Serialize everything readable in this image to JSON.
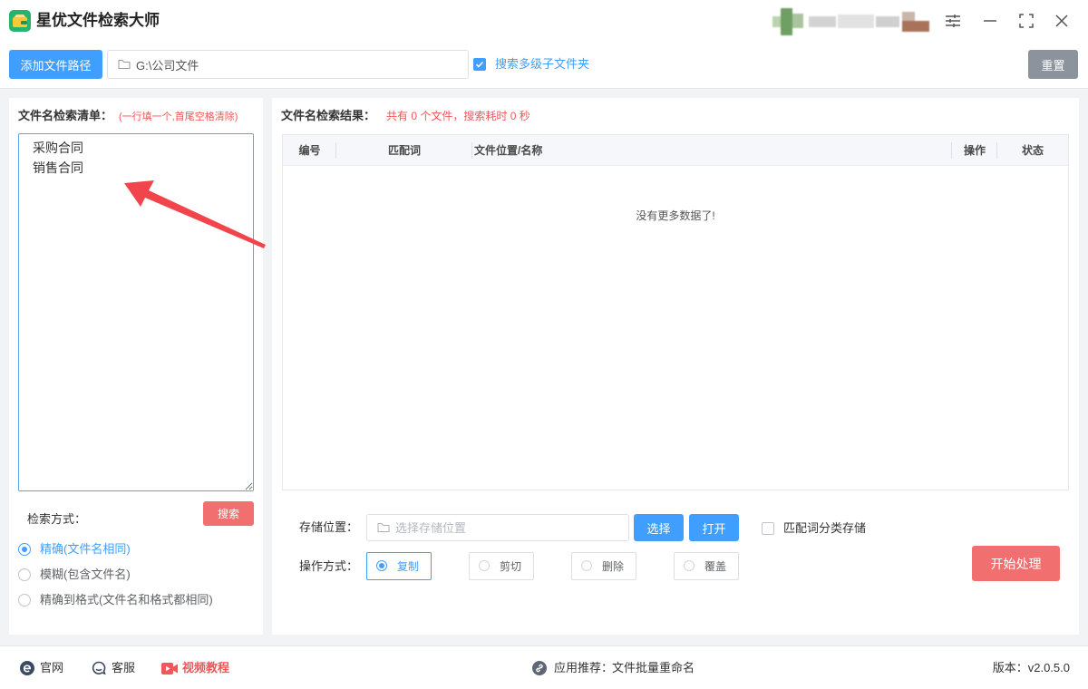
{
  "theme": {
    "primary": "#409eff",
    "danger": "#f26f6f",
    "muted": "#8d939c",
    "hint": "#f25656",
    "arrow": "#f2454b",
    "video": "#f0565a"
  },
  "app": {
    "title": "星优文件检索大师",
    "icons": [
      "app-logo-icon",
      "settings-sliders-icon",
      "minimize-icon",
      "maximize-icon",
      "close-icon"
    ]
  },
  "toolbar": {
    "add_path_label": "添加文件路径",
    "path_value": "G:\\公司文件",
    "subfolder_checked": true,
    "subfolder_label": "搜索多级子文件夹",
    "reset_label": "重置"
  },
  "left_panel": {
    "list_label": "文件名检索清单：",
    "list_hint": "(一行填一个,首尾空格清除)",
    "list_value": "采购合同\n销售合同",
    "mode_label": "检索方式：",
    "search_label": "搜索",
    "modes": [
      {
        "label": "精确(文件名相同)",
        "selected": true
      },
      {
        "label": "模糊(包含文件名)",
        "selected": false
      },
      {
        "label": "精确到格式(文件名和格式都相同)",
        "selected": false
      }
    ]
  },
  "results": {
    "label": "文件名检索结果：",
    "summary": "共有 0 个文件，搜索耗时 0 秒",
    "columns": [
      "编号",
      "匹配词",
      "文件位置/名称",
      "操作",
      "状态"
    ],
    "empty_text": "没有更多数据了!"
  },
  "storage": {
    "label": "存储位置：",
    "placeholder": "选择存储位置",
    "choose_label": "选择",
    "open_label": "打开",
    "classify_checked": false,
    "classify_label": "匹配词分类存储"
  },
  "operation": {
    "label": "操作方式：",
    "options": [
      {
        "label": "复制",
        "selected": true
      },
      {
        "label": "剪切",
        "selected": false
      },
      {
        "label": "删除",
        "selected": false
      },
      {
        "label": "覆盖",
        "selected": false
      }
    ],
    "start_label": "开始处理"
  },
  "footer": {
    "website_label": "官网",
    "support_label": "客服",
    "tutorial_label": "视频教程",
    "recommend_label": "应用推荐：",
    "recommend_app": "文件批量重命名",
    "version": "版本：v2.0.5.0"
  }
}
